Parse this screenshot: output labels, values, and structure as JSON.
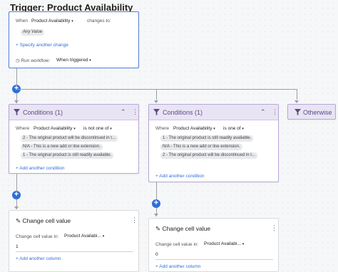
{
  "title": "Trigger: Product Availability",
  "trigger": {
    "when_label": "When",
    "when_field": "Product Availability",
    "changes_to": "changes to:",
    "any_value": "Any Value",
    "specify_link": "Specify another change",
    "run_label": "Run workflow:",
    "run_value": "When triggered"
  },
  "conditions_left": {
    "title": "Conditions (1)",
    "where": "Where",
    "field": "Product Availability",
    "operator": "is not one of",
    "chips": [
      "2 - The original product will be discontinued in t...",
      "N/A - This is a new add or line extension.",
      "1 - The original product is still readily available."
    ],
    "add_link": "Add another condition"
  },
  "conditions_right": {
    "title": "Conditions (1)",
    "where": "Where",
    "field": "Product Availability",
    "operator": "is one of",
    "chips": [
      "1 - The original product is still readily available.",
      "N/A - This is a new add or line extension.",
      "2 - The original product will be discontinued in t..."
    ],
    "add_link": "Add another condition"
  },
  "otherwise": {
    "label": "Otherwise"
  },
  "ccv_left": {
    "title": "Change cell value",
    "label": "Change cell value in:",
    "column": "Product Availabi...",
    "value": "1",
    "add_link": "Add another column"
  },
  "ccv_right": {
    "title": "Change cell value",
    "label": "Change cell value in:",
    "column": "Product Availabi...",
    "value": "0",
    "add_link": "Add another column"
  },
  "colors": {
    "accent": "#2f6fd6",
    "condition_header": "#e9e4f4",
    "condition_text": "#5b4a86"
  }
}
